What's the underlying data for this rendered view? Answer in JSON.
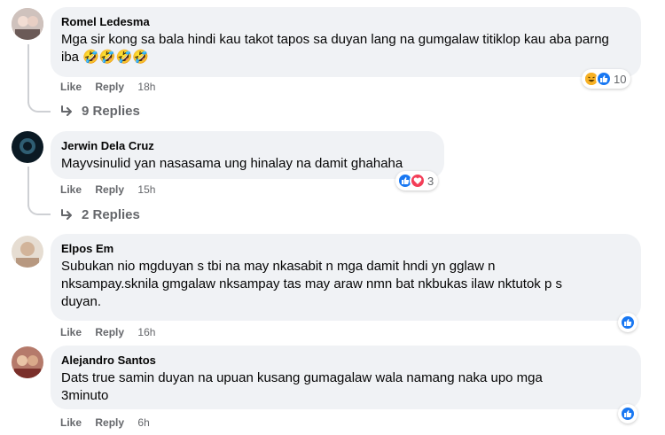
{
  "comments": [
    {
      "author": "Romel Ledesma",
      "text": "Mga sir kong sa bala hindi kau takot tapos sa duyan lang na gumgalaw titiklop kau aba parng iba 🤣🤣🤣🤣",
      "like_label": "Like",
      "reply_label": "Reply",
      "time": "18h",
      "reaction_icons": [
        "haha-icon",
        "like-icon"
      ],
      "reaction_count": "10",
      "replies_label": "9 Replies"
    },
    {
      "author": "Jerwin Dela Cruz",
      "text": "Mayvsinulid yan nasasama ung hinalay na damit ghahaha",
      "like_label": "Like",
      "reply_label": "Reply",
      "time": "15h",
      "reaction_icons": [
        "like-icon",
        "love-icon"
      ],
      "reaction_count": "3",
      "replies_label": "2 Replies"
    },
    {
      "author": "Elpos Em",
      "text": "Subukan nio mgduyan s tbi na may nkasabit n mga damit hndi yn gglaw n nksampay.sknila gmgalaw nksampay tas may araw nmn bat nkbukas ilaw nktutok p s duyan.",
      "like_label": "Like",
      "reply_label": "Reply",
      "time": "16h",
      "reaction_icons": [
        "like-icon"
      ]
    },
    {
      "author": "Alejandro Santos",
      "text": "Dats true samin duyan na upuan kusang gumagalaw wala namang naka upo mga 3minuto",
      "like_label": "Like",
      "reply_label": "Reply",
      "time": "6h",
      "reaction_icons": [
        "like-icon"
      ]
    }
  ],
  "colors": {
    "bubble": "#f0f2f5",
    "meta": "#65676b",
    "like": "#1877f2",
    "love": "#f33e58",
    "haha": "#f7b125"
  }
}
